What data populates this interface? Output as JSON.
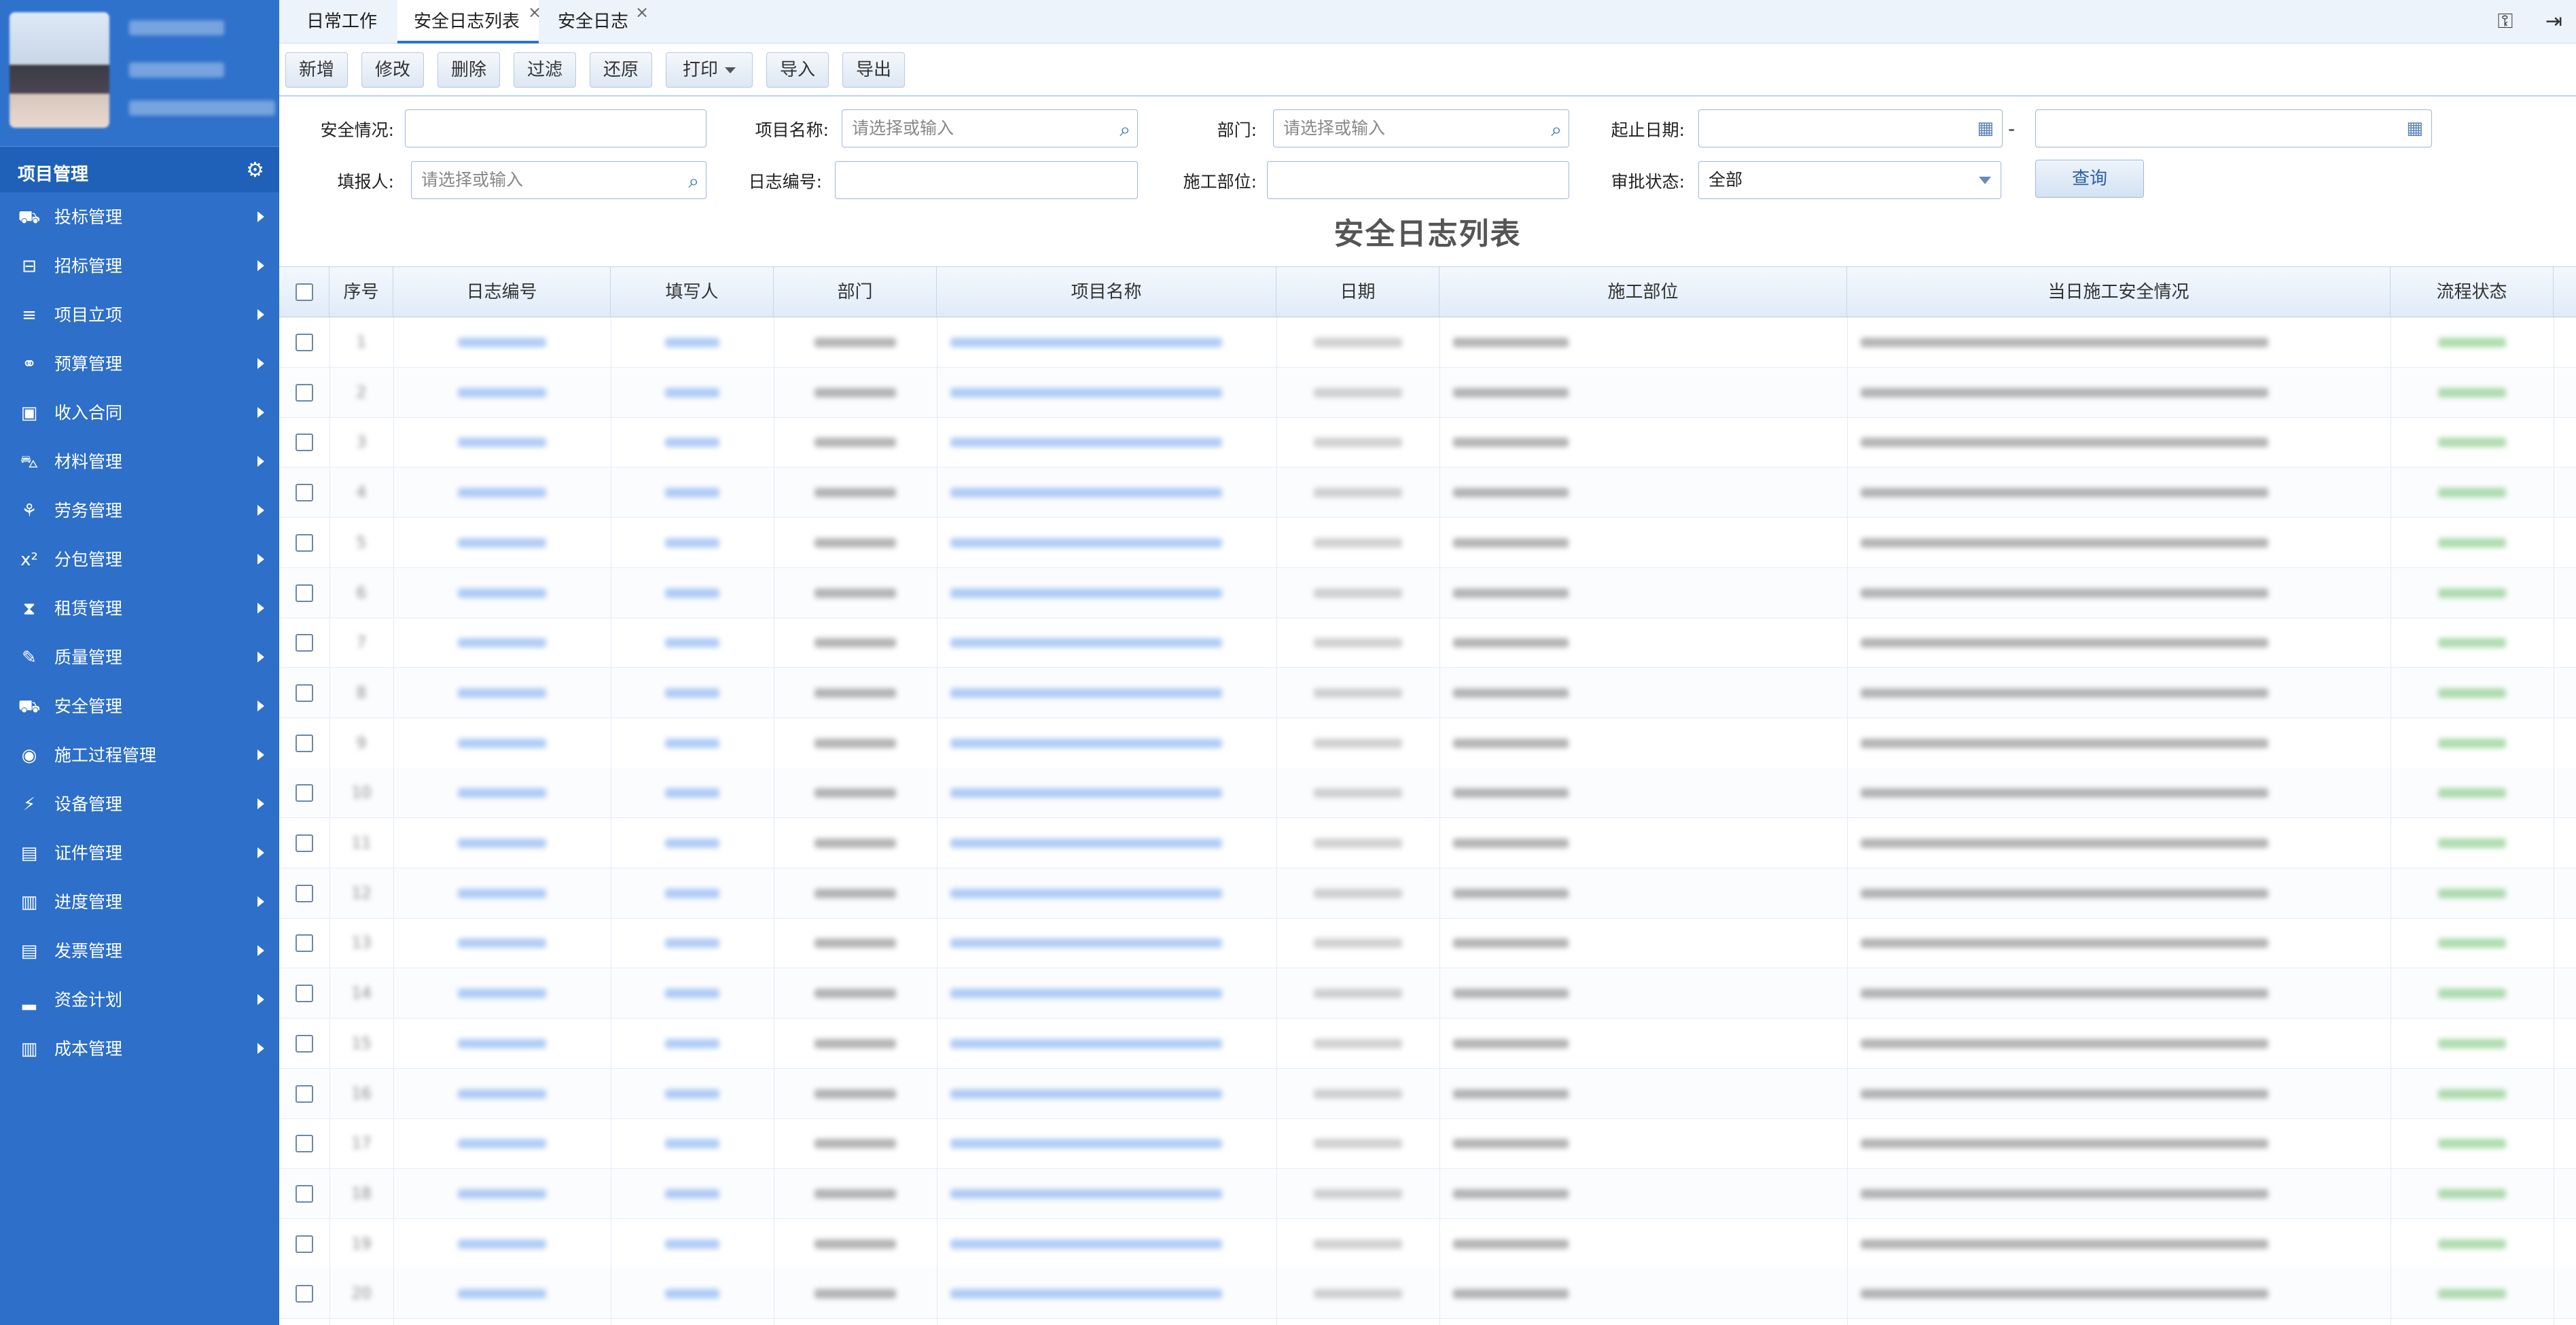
{
  "sidebar": {
    "profile": {
      "lines": [
        "",
        "",
        ""
      ]
    },
    "section_title": "项目管理",
    "items": [
      {
        "label": "投标管理",
        "icon": "road-icon"
      },
      {
        "label": "招标管理",
        "icon": "inbox-icon"
      },
      {
        "label": "项目立项",
        "icon": "list-icon"
      },
      {
        "label": "预算管理",
        "icon": "link-icon"
      },
      {
        "label": "收入合同",
        "icon": "money-icon"
      },
      {
        "label": "材料管理",
        "icon": "cart-icon"
      },
      {
        "label": "劳务管理",
        "icon": "handshake-icon"
      },
      {
        "label": "分包管理",
        "icon": "superscript-icon"
      },
      {
        "label": "租赁管理",
        "icon": "hourglass-icon"
      },
      {
        "label": "质量管理",
        "icon": "edit-icon"
      },
      {
        "label": "安全管理",
        "icon": "bus-icon"
      },
      {
        "label": "施工过程管理",
        "icon": "compass-icon"
      },
      {
        "label": "设备管理",
        "icon": "plug-icon"
      },
      {
        "label": "证件管理",
        "icon": "id-card-icon"
      },
      {
        "label": "进度管理",
        "icon": "bar-chart-icon"
      },
      {
        "label": "发票管理",
        "icon": "file-icon"
      },
      {
        "label": "资金计划",
        "icon": "signal-icon"
      },
      {
        "label": "成本管理",
        "icon": "bar-chart-icon"
      }
    ]
  },
  "tabs": [
    {
      "label": "日常工作"
    },
    {
      "label": "安全日志列表",
      "active": true,
      "closable": true
    },
    {
      "label": "安全日志",
      "closable": true
    }
  ],
  "toolbar": {
    "add": "新增",
    "edit": "修改",
    "delete": "删除",
    "filter": "过滤",
    "restore": "还原",
    "print": "打印",
    "import": "导入",
    "export": "导出"
  },
  "filters": {
    "safety_label": "安全情况:",
    "project_label": "项目名称:",
    "project_placeholder": "请选择或输入",
    "dept_label": "部门:",
    "dept_placeholder": "请选择或输入",
    "date_label": "起止日期:",
    "date_sep": "-",
    "reporter_label": "填报人:",
    "reporter_placeholder": "请选择或输入",
    "log_no_label": "日志编号:",
    "location_label": "施工部位:",
    "approval_label": "审批状态:",
    "approval_value": "全部",
    "query": "查询"
  },
  "list_title": "安全日志列表",
  "table": {
    "headers": [
      "序号",
      "日志编号",
      "填写人",
      "部门",
      "项目名称",
      "日期",
      "施工部位",
      "当日施工安全情况",
      "流程状态"
    ],
    "rows": [
      [
        "1",
        "",
        "",
        "",
        "",
        "",
        "",
        "",
        ""
      ],
      [
        "2",
        "",
        "",
        "",
        "",
        "",
        "",
        "",
        ""
      ],
      [
        "3",
        "",
        "",
        "",
        "",
        "",
        "",
        "",
        ""
      ],
      [
        "4",
        "",
        "",
        "",
        "",
        "",
        "",
        "",
        ""
      ],
      [
        "5",
        "",
        "",
        "",
        "",
        "",
        "",
        "",
        ""
      ],
      [
        "6",
        "",
        "",
        "",
        "",
        "",
        "",
        "",
        ""
      ],
      [
        "7",
        "",
        "",
        "",
        "",
        "",
        "",
        "",
        ""
      ],
      [
        "8",
        "",
        "",
        "",
        "",
        "",
        "",
        "",
        ""
      ],
      [
        "9",
        "",
        "",
        "",
        "",
        "",
        "",
        "",
        ""
      ],
      [
        "10",
        "",
        "",
        "",
        "",
        "",
        "",
        "",
        ""
      ],
      [
        "11",
        "",
        "",
        "",
        "",
        "",
        "",
        "",
        ""
      ],
      [
        "12",
        "",
        "",
        "",
        "",
        "",
        "",
        "",
        ""
      ],
      [
        "13",
        "",
        "",
        "",
        "",
        "",
        "",
        "",
        ""
      ],
      [
        "14",
        "",
        "",
        "",
        "",
        "",
        "",
        "",
        ""
      ],
      [
        "15",
        "",
        "",
        "",
        "",
        "",
        "",
        "",
        ""
      ],
      [
        "16",
        "",
        "",
        "",
        "",
        "",
        "",
        "",
        ""
      ],
      [
        "17",
        "",
        "",
        "",
        "",
        "",
        "",
        "",
        ""
      ],
      [
        "18",
        "",
        "",
        "",
        "",
        "",
        "",
        "",
        ""
      ],
      [
        "19",
        "",
        "",
        "",
        "",
        "",
        "",
        "",
        ""
      ],
      [
        "20",
        "",
        "",
        "",
        "",
        "",
        "",
        "",
        ""
      ]
    ]
  },
  "colors": {
    "sidebar": "#2d6fc9",
    "accent": "#2b72d1",
    "link": "#3a7de0",
    "status": "#3aa33a"
  }
}
